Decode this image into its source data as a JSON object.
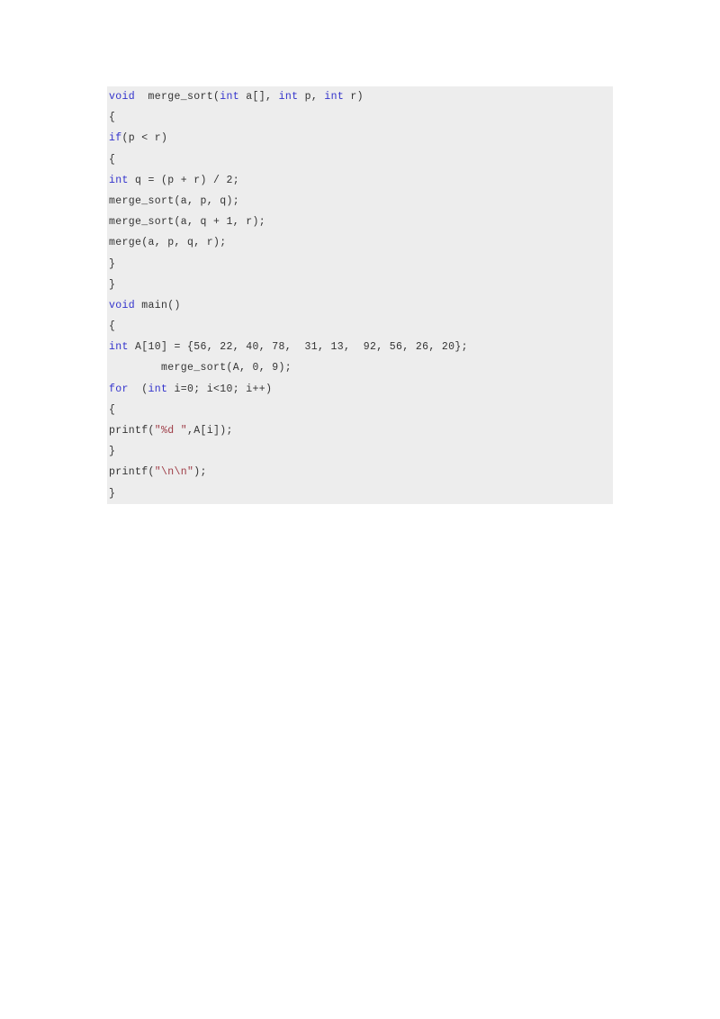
{
  "document": {
    "type": "code-listing",
    "language": "C",
    "panel_background": "#ededed",
    "keyword_color": "#3333cc",
    "string_color": "#9e3b45",
    "text_color": "#333333",
    "code_lines": [
      {
        "segments": [
          {
            "t": "void",
            "c": "kw"
          },
          {
            "t": "  merge_sort(",
            "c": "plain"
          },
          {
            "t": "int",
            "c": "kw"
          },
          {
            "t": " a[], ",
            "c": "plain"
          },
          {
            "t": "int",
            "c": "kw"
          },
          {
            "t": " p, ",
            "c": "plain"
          },
          {
            "t": "int",
            "c": "kw"
          },
          {
            "t": " r)",
            "c": "plain"
          }
        ]
      },
      {
        "segments": [
          {
            "t": "{",
            "c": "plain"
          }
        ]
      },
      {
        "segments": [
          {
            "t": "if",
            "c": "kw"
          },
          {
            "t": "(p < r)",
            "c": "plain"
          }
        ]
      },
      {
        "segments": [
          {
            "t": "{",
            "c": "plain"
          }
        ]
      },
      {
        "segments": [
          {
            "t": "int",
            "c": "kw"
          },
          {
            "t": " q = (p + r) / 2;",
            "c": "plain"
          }
        ]
      },
      {
        "segments": [
          {
            "t": "merge_sort(a, p, q);",
            "c": "plain"
          }
        ]
      },
      {
        "segments": [
          {
            "t": "merge_sort(a, q + 1, r);",
            "c": "plain"
          }
        ]
      },
      {
        "segments": [
          {
            "t": "merge(a, p, q, r);",
            "c": "plain"
          }
        ]
      },
      {
        "segments": [
          {
            "t": "}",
            "c": "plain"
          }
        ]
      },
      {
        "segments": [
          {
            "t": "}",
            "c": "plain"
          }
        ]
      },
      {
        "segments": [
          {
            "t": "void",
            "c": "kw"
          },
          {
            "t": " main()",
            "c": "plain"
          }
        ]
      },
      {
        "segments": [
          {
            "t": "{",
            "c": "plain"
          }
        ]
      },
      {
        "segments": [
          {
            "t": "int",
            "c": "kw"
          },
          {
            "t": " A[10] = {56, 22, 40, 78,  31, 13,  92, 56, 26, 20};",
            "c": "plain"
          }
        ]
      },
      {
        "segments": [
          {
            "t": "        merge_sort(A, 0, 9);",
            "c": "plain"
          }
        ]
      },
      {
        "segments": [
          {
            "t": "for",
            "c": "kw"
          },
          {
            "t": "  (",
            "c": "plain"
          },
          {
            "t": "int",
            "c": "kw"
          },
          {
            "t": " i=0; i<10; i++)",
            "c": "plain"
          }
        ]
      },
      {
        "segments": [
          {
            "t": "{",
            "c": "plain"
          }
        ]
      },
      {
        "segments": [
          {
            "t": "printf(",
            "c": "plain"
          },
          {
            "t": "\"%d \"",
            "c": "str"
          },
          {
            "t": ",A[i]);",
            "c": "plain"
          }
        ]
      },
      {
        "segments": [
          {
            "t": "}",
            "c": "plain"
          }
        ]
      },
      {
        "segments": [
          {
            "t": "printf(",
            "c": "plain"
          },
          {
            "t": "\"\\n\\n\"",
            "c": "str"
          },
          {
            "t": ");",
            "c": "plain"
          }
        ]
      },
      {
        "segments": [
          {
            "t": "}",
            "c": "plain"
          }
        ]
      }
    ]
  }
}
